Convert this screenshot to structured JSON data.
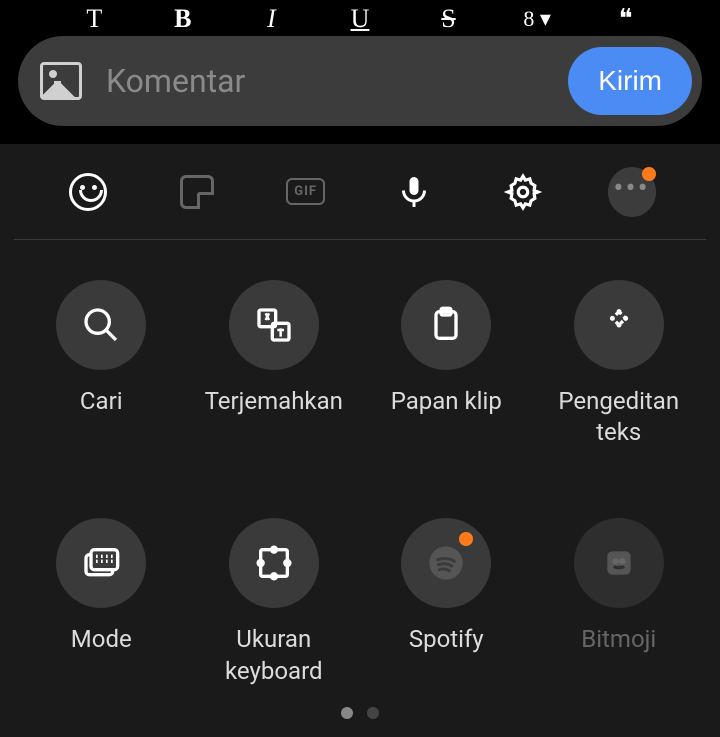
{
  "format_bar": {
    "text": "T",
    "bold": "B",
    "italic": "I",
    "underline": "U",
    "strike": "S",
    "list_num": "8 ▾",
    "quote": "❝"
  },
  "comment": {
    "placeholder": "Komentar",
    "send_label": "Kirim"
  },
  "toolbar": {
    "gif_label": "GIF"
  },
  "tools": [
    {
      "label": "Cari"
    },
    {
      "label": "Terjemahkan"
    },
    {
      "label": "Papan klip"
    },
    {
      "label": "Pengeditan teks"
    },
    {
      "label": "Mode"
    },
    {
      "label": "Ukuran keyboard"
    },
    {
      "label": "Spotify"
    },
    {
      "label": "Bitmoji"
    }
  ]
}
